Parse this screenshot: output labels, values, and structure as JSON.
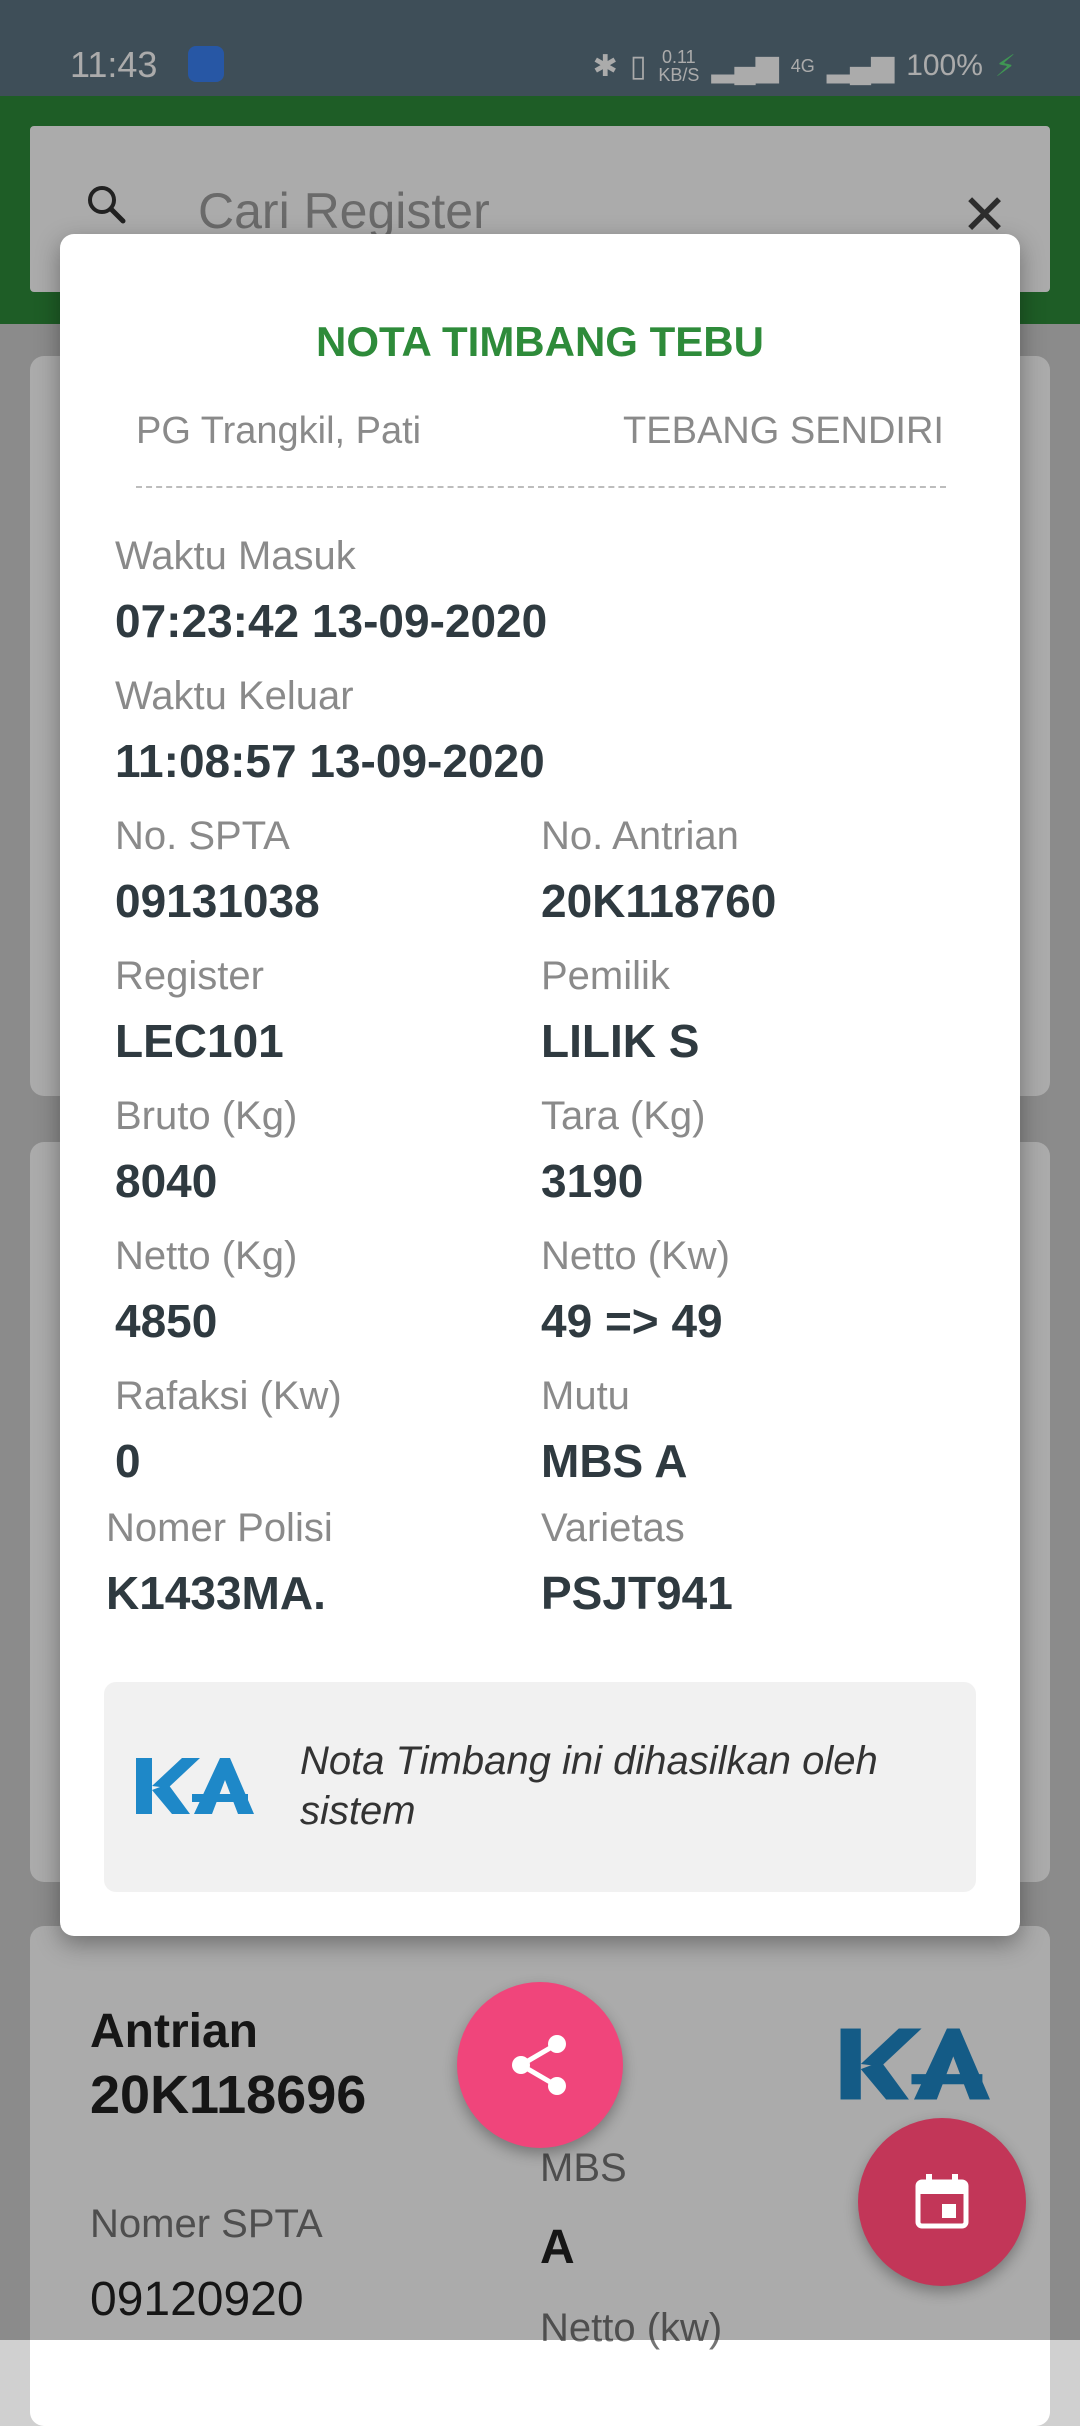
{
  "status_bar": {
    "time": "11:43",
    "net_speed_top": "0.11",
    "net_speed_bottom": "KB/S",
    "network": "4G",
    "battery": "100%",
    "icons": [
      "android-notification-icon",
      "bluetooth-icon",
      "vibrate-icon",
      "signal-icon",
      "battery-charging-icon"
    ]
  },
  "search": {
    "placeholder": "Cari Register"
  },
  "background_card": {
    "antrian_label": "Antrian",
    "antrian_value": "20K118696",
    "spta_label": "Nomer SPTA",
    "spta_value": "09120920",
    "mbs_label": "MBS",
    "mbs_value": "A",
    "netto_label": "Netto (kw)"
  },
  "dialog": {
    "title": "NOTA TIMBANG TEBU",
    "location": "PG Trangkil, Pati",
    "type": "TEBANG SENDIRI",
    "waktu_masuk_label": "Waktu Masuk",
    "waktu_masuk_value": "07:23:42 13-09-2020",
    "waktu_keluar_label": "Waktu Keluar",
    "waktu_keluar_value": "11:08:57 13-09-2020",
    "fields": {
      "spta_label": "No. SPTA",
      "spta_value": "09131038",
      "antrian_label": "No. Antrian",
      "antrian_value": "20K118760",
      "register_label": "Register",
      "register_value": "LEC101",
      "pemilik_label": "Pemilik",
      "pemilik_value": "LILIK S",
      "bruto_label": "Bruto (Kg)",
      "bruto_value": "8040",
      "tara_label": "Tara (Kg)",
      "tara_value": "3190",
      "netto_kg_label": "Netto (Kg)",
      "netto_kg_value": "4850",
      "netto_kw_label": "Netto (Kw)",
      "netto_kw_value": "49 => 49",
      "rafaksi_label": "Rafaksi (Kw)",
      "rafaksi_value": "0",
      "mutu_label": "Mutu",
      "mutu_value": "MBS A",
      "polisi_label": "Nomer Polisi",
      "polisi_value": "K1433MA.",
      "varietas_label": "Varietas",
      "varietas_value": "PSJT941"
    },
    "note_text": "Nota Timbang ini dihasilkan oleh sistem"
  },
  "fabs": {
    "share_icon": "share-icon",
    "calendar_icon": "calendar-icon"
  },
  "colors": {
    "brand_green": "#2e8b3a",
    "share_fab": "#f0457b",
    "calendar_fab": "#c23658",
    "logo_blue": "#1e88c8"
  }
}
